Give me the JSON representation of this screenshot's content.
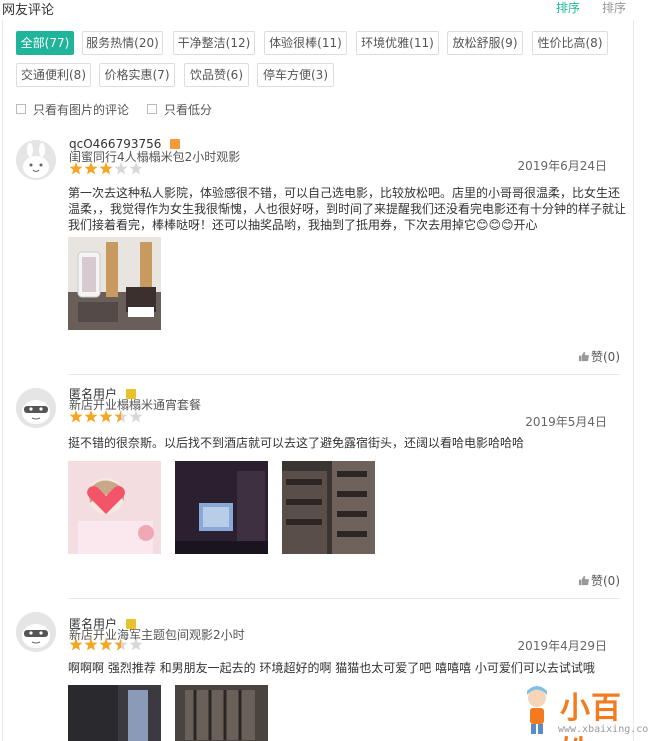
{
  "header": {
    "title": "网友评论",
    "sort_active": "排序",
    "sort_inactive": "排序"
  },
  "tags": [
    {
      "label": "全部(77)",
      "active": true
    },
    {
      "label": "服务热情(20)"
    },
    {
      "label": "干净整洁(12)"
    },
    {
      "label": "体验很棒(11)"
    },
    {
      "label": "环境优雅(11)"
    },
    {
      "label": "放松舒服(9)"
    },
    {
      "label": "性价比高(8)"
    },
    {
      "label": "交通便利(8)"
    },
    {
      "label": "价格实惠(7)"
    },
    {
      "label": "饮品赞(6)"
    },
    {
      "label": "停车方便(3)"
    }
  ],
  "filters": {
    "with_photos": "只看有图片的评论",
    "low_scores": "只看低分"
  },
  "reviews": [
    {
      "username": "qcO466793756",
      "package": "闺蜜同行4人榻榻米包2小时观影",
      "rating": 3,
      "date": "2019年6月24日",
      "content": "第一次去这种私人影院，体验感很不错，可以自己选电影，比较放松吧。店里的小哥哥很温柔，比女生还温柔，，我觉得作为女生我很惭愧，人也很好呀，到时间了来提醒我们还没看完电影还有十分钟的样子就让我们接着看完，棒棒哒呀！还可以抽奖品哟，我抽到了抵用券，下次去用掉它😊😊😊开心",
      "like": "赞(0)"
    },
    {
      "username": "匿名用户",
      "package": "新店开业榻榻米通宵套餐",
      "rating": 3.5,
      "date": "2019年5月4日",
      "content": "挺不错的很奈斯。以后找不到酒店就可以去这了避免露宿街头，还阔以看哈电影哈哈哈",
      "like": "赞(0)"
    },
    {
      "username": "匿名用户",
      "package": "新店开业海军主题包间观影2小时",
      "rating": 3.5,
      "date": "2019年4月29日",
      "content": "啊啊啊 强烈推荐 和男朋友一起去的 环境超好的啊 猫猫也太可爱了吧 嘻嘻嘻 小可爱们可以去试试哦"
    }
  ],
  "watermark": {
    "text": "小百姓",
    "url": "www.xbaixing.com"
  },
  "colors": {
    "accent": "#20b59b",
    "star": "#f5a623",
    "star_empty": "#d8d8d8"
  }
}
